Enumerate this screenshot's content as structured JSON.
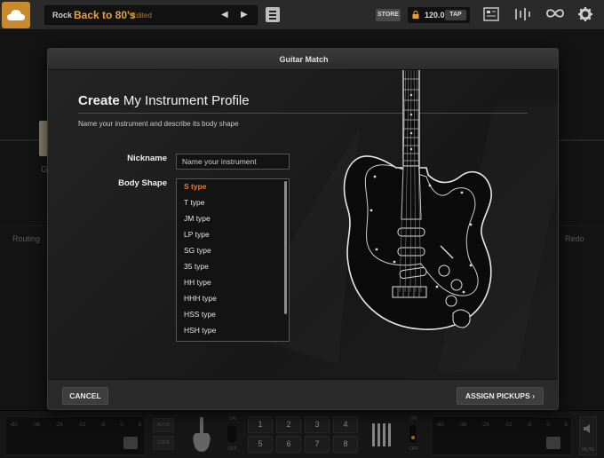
{
  "topbar": {
    "logo_icon": "cloud-logo-icon",
    "preset_genre": "Rock",
    "preset_name": "Back to 80's",
    "preset_edited": "*Edited",
    "prev_glyph": "◀",
    "next_glyph": "▶",
    "store_label": "STORE",
    "tempo": "120.0",
    "tap_label": "TAP",
    "accent_color": "#e7a23a"
  },
  "background": {
    "routing_label": "Routing",
    "redo_label": "Redo",
    "chain_label": "G"
  },
  "modal": {
    "title": "Guitar Match",
    "heading_bold": "Create",
    "heading_rest": " My Instrument Profile",
    "subtitle": "Name your instrument and describe its body shape",
    "nickname_label": "Nickname",
    "nickname_placeholder": "Name your instrument",
    "body_shape_label": "Body Shape",
    "body_shapes": [
      "S type",
      "T type",
      "JM type",
      "LP type",
      "SG type",
      "35 type",
      "HH type",
      "HHH type",
      "HSS type",
      "HSH type"
    ],
    "selected_shape": "S type",
    "selected_color": "#e77a2a",
    "cancel_label": "CANCEL",
    "assign_label": "ASSIGN PICKUPS ›"
  },
  "bottombar": {
    "meter_scale": [
      "-60",
      "-36",
      "-24",
      "-12",
      "-6",
      "0",
      "6"
    ],
    "auto_label": "AUTO",
    "lock_label": "LOCK",
    "on_label": "ON",
    "off_label": "OFF",
    "pads": [
      "1",
      "2",
      "3",
      "4",
      "5",
      "6",
      "7",
      "8"
    ],
    "mute_label": "MUTE"
  }
}
